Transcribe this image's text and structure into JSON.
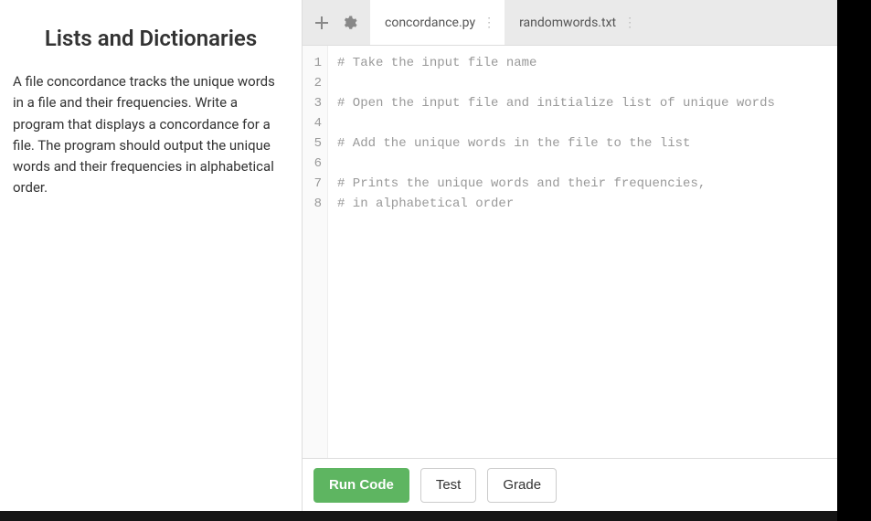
{
  "sidebar": {
    "title": "Lists and Dictionaries",
    "body": "A file concordance tracks the unique words in a file and their frequencies. Write a program that displays a concordance for a file. The program should output the unique words and their frequencies in alphabetical order."
  },
  "toolbar": {
    "add_icon": "plus-icon",
    "settings_icon": "gear-icon"
  },
  "tabs": [
    {
      "label": "concordance.py",
      "active": true
    },
    {
      "label": "randomwords.txt",
      "active": false
    }
  ],
  "editor": {
    "lines": [
      "# Take the input file name",
      "",
      "# Open the input file and initialize list of unique words",
      "",
      "# Add the unique words in the file to the list",
      "",
      "# Prints the unique words and their frequencies,",
      "# in alphabetical order"
    ]
  },
  "footer": {
    "run_label": "Run Code",
    "test_label": "Test",
    "grade_label": "Grade"
  }
}
